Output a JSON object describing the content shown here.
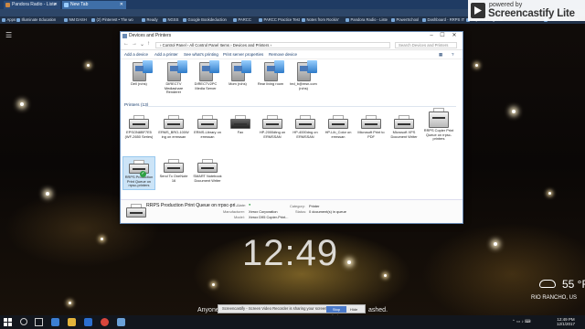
{
  "browser": {
    "tabs": [
      {
        "label": "Pandora Radio - Liste"
      },
      {
        "label": "New Tab"
      }
    ],
    "bookmarks": [
      "Apps",
      "Illuminate Education",
      "NM DASH",
      "(2) Pinterest • The wo",
      "Ready",
      "NGSS",
      "Google Bookdeduction",
      "PARCC",
      "PARCC Practice Test",
      "Notes from Rockin'",
      "Pandora Radio - Liste",
      "PowerSchool",
      "Dashboard - RRPS IT",
      "PaperCut Login for",
      "Other bookmarks"
    ]
  },
  "screencastify": {
    "powered_by": "powered by",
    "name": "Screencastify Lite"
  },
  "window": {
    "title": "Devices and Printers",
    "breadcrumb": "› Control Panel › All Control Panel Items › Devices and Printers ›",
    "search_placeholder": "Search Devices and Printers",
    "commands": [
      "Add a device",
      "Add a printer",
      "See what's printing",
      "Print server properties",
      "Remove device"
    ],
    "devices": [
      {
        "label": "Dell (rchs)"
      },
      {
        "label": "DIRECTV Mediashare Renderer"
      },
      {
        "label": "DIRECTV2PC Media Server"
      },
      {
        "label": "Mom (rchs)"
      },
      {
        "label": "Rear living room"
      },
      {
        "label": "ted_b@msn.com (rchs)"
      }
    ],
    "printers_header": "Printers (13)",
    "printers": [
      {
        "label": "EPSON8BF7E5 (WF-2650 Series)"
      },
      {
        "label": "ERMS_BRO-100W ing on ermssan"
      },
      {
        "label": "ERMS-Library on ermssan"
      },
      {
        "label": "Fax"
      },
      {
        "label": "HP-2000dtng on ERMSSAN"
      },
      {
        "label": "HP-4000dng on ERMSSAN"
      },
      {
        "label": "HP-Lib_Color on ermssan"
      },
      {
        "label": "Microsoft Print to PDF"
      },
      {
        "label": "Microsoft XPS Document Writer"
      },
      {
        "label": "RRPS Copier Print Queue on rrpsc-printers"
      },
      {
        "label": "RRPS Production Print Queue on rrpsc-printers"
      },
      {
        "label": "Send To OneNote 16"
      },
      {
        "label": "SMART Notebook Document Writer"
      }
    ],
    "details": {
      "name": "RRPS Production Print Queue on rrpsc-pri...",
      "state_label": "State:",
      "manufacturer_label": "Manufacturer:",
      "manufacturer": "Xerox Corporation",
      "model_label": "Model:",
      "model": "Xerox D95 Copier-Print...",
      "category_label": "Category:",
      "category": "Printer",
      "status_label": "Status:",
      "status": "0 document(s) in queue"
    }
  },
  "desktop": {
    "clock": "12:49",
    "temperature": "55 °F",
    "city": "RIO RANCHO, US",
    "caption_left": "Anyone",
    "caption_right": "ashed."
  },
  "share_banner": {
    "text": "Screencastify - Screen Video Recorder is sharing your screen.",
    "stop": "Stop sharing",
    "hide": "Hide"
  },
  "taskbar": {
    "time": "12:49 PM",
    "date": "12/1/2017"
  },
  "colors": {
    "taskbar": "#12161d",
    "window_border": "#6a8bb5",
    "selection": "#cce4f7"
  }
}
